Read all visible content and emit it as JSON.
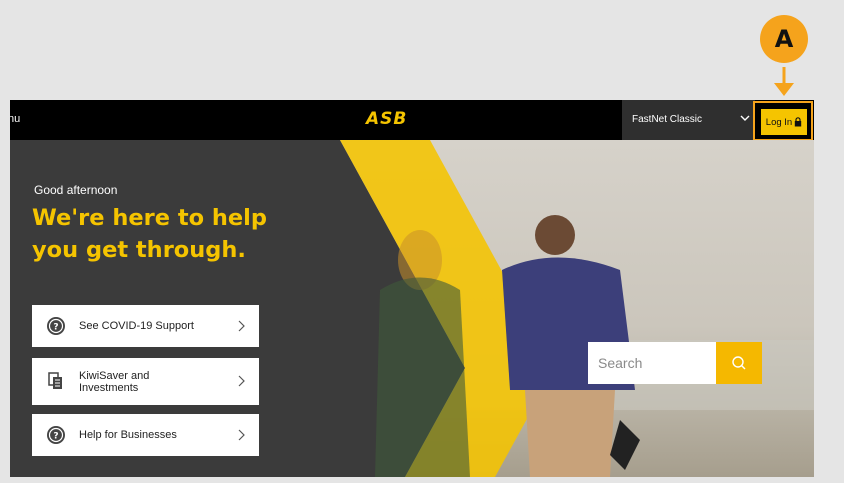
{
  "annotation": {
    "badge_letter": "A",
    "accent_color": "#f5a31c"
  },
  "header": {
    "menu_label": "nu",
    "logo_text": "ASB",
    "fastnet_select": {
      "selected": "FastNet Classic"
    },
    "login_label": "Log In",
    "brand_color": "#f5c400"
  },
  "hero": {
    "greeting": "Good afternoon",
    "headline": "We're here to help you get through.",
    "cards": [
      {
        "label": "See COVID-19 Support",
        "icon": "help-circle-icon"
      },
      {
        "label": "KiwiSaver and\nInvestments",
        "icon": "documents-icon"
      },
      {
        "label": "Help for Businesses",
        "icon": "help-circle-icon"
      }
    ]
  },
  "search": {
    "placeholder": "Search",
    "icon": "search-icon"
  }
}
